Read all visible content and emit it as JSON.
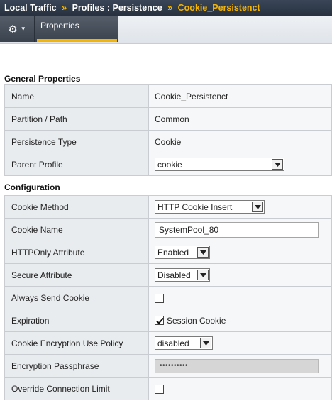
{
  "breadcrumb": {
    "part1": "Local Traffic",
    "sep1": "»",
    "part2": "Profiles : Persistence",
    "sep2": "»",
    "current": "Cookie_Persistenct"
  },
  "tabs": {
    "gear_icon": "gear-icon",
    "properties_label": "Properties"
  },
  "general": {
    "heading": "General Properties",
    "name_label": "Name",
    "name_value": "Cookie_Persistenct",
    "partition_label": "Partition / Path",
    "partition_value": "Common",
    "ptype_label": "Persistence Type",
    "ptype_value": "Cookie",
    "parent_label": "Parent Profile",
    "parent_value": "cookie"
  },
  "config": {
    "heading": "Configuration",
    "method_label": "Cookie Method",
    "method_value": "HTTP Cookie Insert",
    "cname_label": "Cookie Name",
    "cname_value": "SystemPool_80",
    "httponly_label": "HTTPOnly Attribute",
    "httponly_value": "Enabled",
    "secure_label": "Secure Attribute",
    "secure_value": "Disabled",
    "always_label": "Always Send Cookie",
    "always_checked": false,
    "expiration_label": "Expiration",
    "expiration_checkbox_label": "Session Cookie",
    "expiration_checked": true,
    "encpolicy_label": "Cookie Encryption Use Policy",
    "encpolicy_value": "disabled",
    "passphrase_label": "Encryption Passphrase",
    "passphrase_value": "••••••••••",
    "override_label": "Override Connection Limit",
    "override_checked": false
  },
  "colors": {
    "accent": "#f5b400",
    "titlebar": "#2f3a4a"
  }
}
